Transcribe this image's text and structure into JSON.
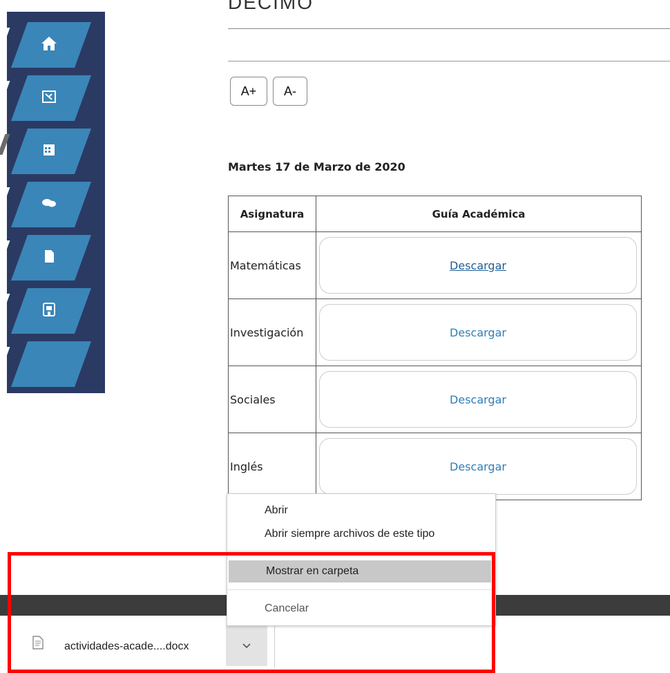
{
  "page": {
    "heading": "DECIMO",
    "font_increase": "A+",
    "font_decrease": "A-",
    "date_title": "Martes 17 de Marzo de 2020"
  },
  "sidebar": {
    "items": [
      {
        "icon": "home-icon"
      },
      {
        "icon": "book-icon"
      },
      {
        "icon": "calendar-grid-icon"
      },
      {
        "icon": "chat-bubbles-icon"
      },
      {
        "icon": "document-icon"
      },
      {
        "icon": "building-icon"
      },
      {
        "icon": ""
      }
    ]
  },
  "table": {
    "headers": [
      "Asignatura",
      "Guía Académica"
    ],
    "rows": [
      {
        "subject": "Matemáticas",
        "action": "Descargar"
      },
      {
        "subject": "Investigación",
        "action": "Descargar"
      },
      {
        "subject": "Sociales",
        "action": "Descargar"
      },
      {
        "subject": "Inglés",
        "action": "Descargar"
      }
    ]
  },
  "context_menu": {
    "items": [
      "Abrir",
      "Abrir siempre archivos de este tipo",
      "Mostrar en carpeta",
      "Cancelar"
    ]
  },
  "download_bar": {
    "file_name": "actividades-acade....docx"
  },
  "colors": {
    "sidebar_bg": "#2b3a63",
    "nav_tile": "#3a86b8",
    "link": "#2f7fb6",
    "highlight_frame": "#ff0000"
  }
}
